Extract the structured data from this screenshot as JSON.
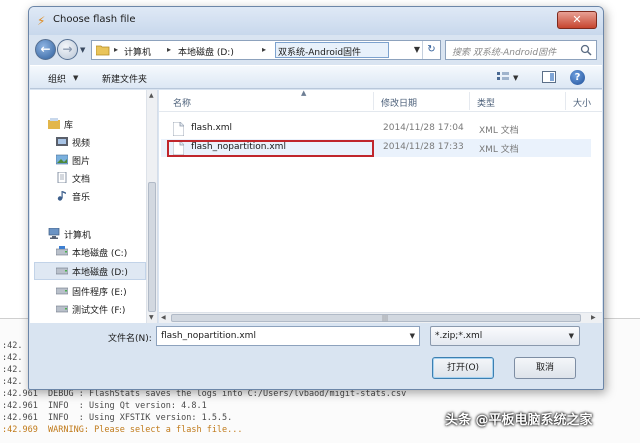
{
  "log": {
    "lines": [
      {
        "text": ":42.",
        "warning": false
      },
      {
        "text": ":42.",
        "warning": false
      },
      {
        "text": ":42.",
        "warning": false
      },
      {
        "text": ":42.",
        "warning": false
      },
      {
        "text": ":42.961  DEBUG : FlashStats saves the logs into C:/Users/lvbaod/migit-stats.csv",
        "warning": false
      },
      {
        "text": ":42.961  INFO  : Using Qt version: 4.8.1",
        "warning": false
      },
      {
        "text": ":42.961  INFO  : Using XFSTIK version: 1.5.5.",
        "warning": false
      },
      {
        "text": ":42.969  WARNING: Please select a flash file...",
        "warning": true
      }
    ]
  },
  "dialog": {
    "title": "Choose flash file",
    "close_label": "✕",
    "breadcrumb": [
      "计算机",
      "本地磁盘 (D:)",
      "双系统-Android固件"
    ],
    "search_placeholder": "搜索 双系统-Android固件",
    "toolbar": {
      "organize": "组织",
      "new_folder": "新建文件夹"
    },
    "nav": {
      "libraries": "库",
      "videos": "视频",
      "pictures": "图片",
      "documents": "文档",
      "music": "音乐",
      "computer": "计算机",
      "drive_c": "本地磁盘 (C:)",
      "drive_d": "本地磁盘 (D:)",
      "drive_e": "固件程序 (E:)",
      "drive_f": "测试文件 (F:)"
    },
    "columns": {
      "name": "名称",
      "modified": "修改日期",
      "type": "类型",
      "size": "大小"
    },
    "files": [
      {
        "name": "flash.xml",
        "modified": "2014/11/28 17:04",
        "type": "XML 文档"
      },
      {
        "name": "flash_nopartition.xml",
        "modified": "2014/11/28 17:33",
        "type": "XML 文档"
      }
    ],
    "filename_label": "文件名(N):",
    "filename_value": "flash_nopartition.xml",
    "filter_value": "*.zip;*.xml",
    "open_label": "打开(O)",
    "cancel_label": "取消"
  },
  "watermark": "头条 @平板电脑系统之家"
}
